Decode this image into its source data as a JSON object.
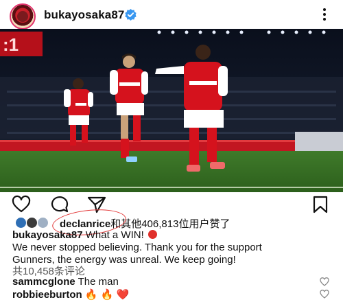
{
  "post": {
    "username": "bukayosaka87",
    "verified": true,
    "verified_color": "#3897f0"
  },
  "actions": {
    "like_icon": "heart-outline-icon",
    "comment_icon": "comment-icon",
    "share_icon": "send-icon",
    "save_icon": "bookmark-icon"
  },
  "likes": {
    "first_liker": "declanrice",
    "rest": "和其他406,813位用户赞了"
  },
  "caption": {
    "username": "bukayosaka87",
    "line1": "What a WIN!",
    "line2": "We never stopped believing. Thank you for the support",
    "line3": "Gunners, the energy was unreal. We keep going!"
  },
  "comments_link": "共10,458条评论",
  "comments": [
    {
      "username": "sammcglone",
      "text": "The man"
    },
    {
      "username": "robbieeburton",
      "text": "🔥 🔥 ❤️"
    }
  ],
  "colors": {
    "accent": "#3897f0",
    "highlight_circle": "#e33a3a",
    "arsenal_red": "#d5121d"
  }
}
